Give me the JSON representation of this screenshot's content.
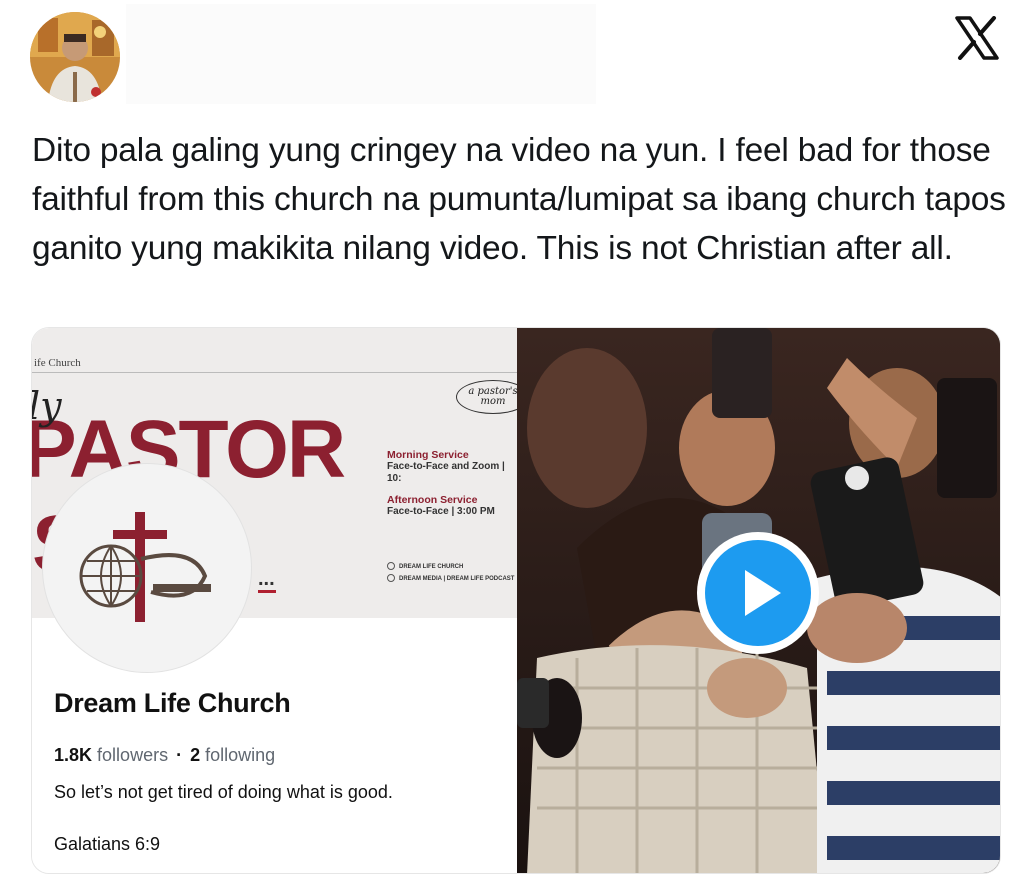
{
  "tweet": {
    "text": "Dito pala galing yung cringey na video na yun. I feel bad for those faithful from this church na pumunta/lumipat sa ibang church tapos ganito yung makikita nilang video. This is not Christian after all."
  },
  "header": {
    "avatar_icon": "user-avatar",
    "close_icon": "x-logo-icon"
  },
  "profile_card": {
    "cover": {
      "church_label": "ife Church",
      "my": "ly",
      "title_word": "PASTOR",
      "subtitle_fragment": "S    O",
      "ellipsis": "...",
      "tag_text": "a pastor's mom",
      "morning_title": "Morning Service",
      "morning_detail": "Face-to-Face and Zoom | 10:",
      "afternoon_title": "Afternoon Service",
      "afternoon_detail": "Face-to-Face | 3:00 PM",
      "social_1": "DREAM LIFE CHURCH",
      "social_2": "DREAM MEDIA | DREAM LIFE PODCAST"
    },
    "name": "Dream Life Church",
    "followers_count": "1.8K",
    "followers_label": "followers",
    "separator": "·",
    "following_count": "2",
    "following_label": "following",
    "bio": "So let’s not get tired of doing what is good.",
    "verse": "Galatians 6:9"
  },
  "video": {
    "play_icon": "play-icon"
  },
  "colors": {
    "accent": "#1d9bf0",
    "church_red": "#8c2030"
  }
}
